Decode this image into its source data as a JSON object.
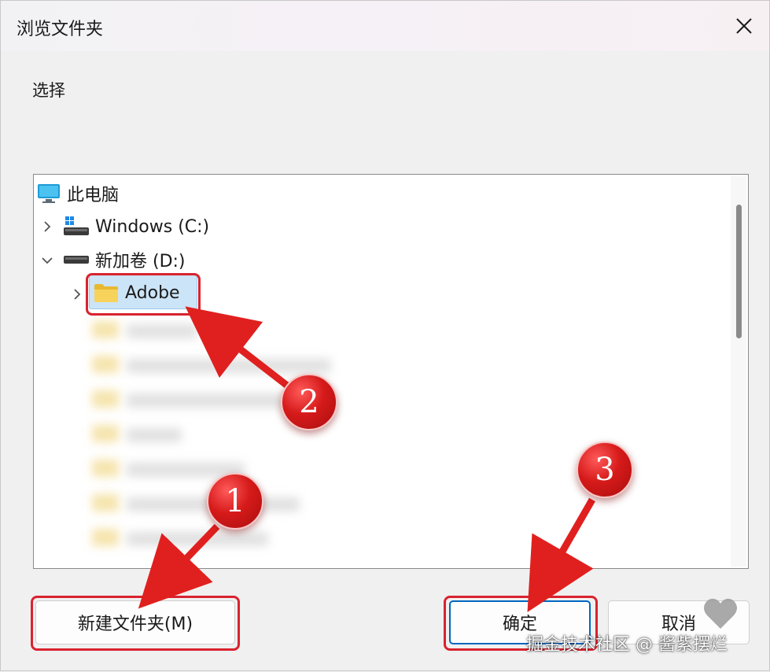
{
  "window": {
    "title": "浏览文件夹"
  },
  "prompt": "选择",
  "tree": {
    "root": {
      "label": "此电脑",
      "icon": "monitor-icon"
    },
    "drives": [
      {
        "label": "Windows (C:)",
        "icon": "windows-drive-icon",
        "expanded": false
      },
      {
        "label": "新加卷 (D:)",
        "icon": "drive-icon",
        "expanded": true
      }
    ],
    "selected_folder": {
      "label": "Adobe",
      "icon": "folder-icon"
    }
  },
  "buttons": {
    "new_folder": "新建文件夹(M)",
    "ok": "确定",
    "cancel": "取消"
  },
  "annotations": {
    "badge1": "1",
    "badge2": "2",
    "badge3": "3"
  },
  "watermark": "掘金技术社区 @ 酱紫摆烂",
  "colors": {
    "accent": "#0067c0",
    "annotation_red": "#d9232f",
    "selection": "#cce4f7"
  }
}
